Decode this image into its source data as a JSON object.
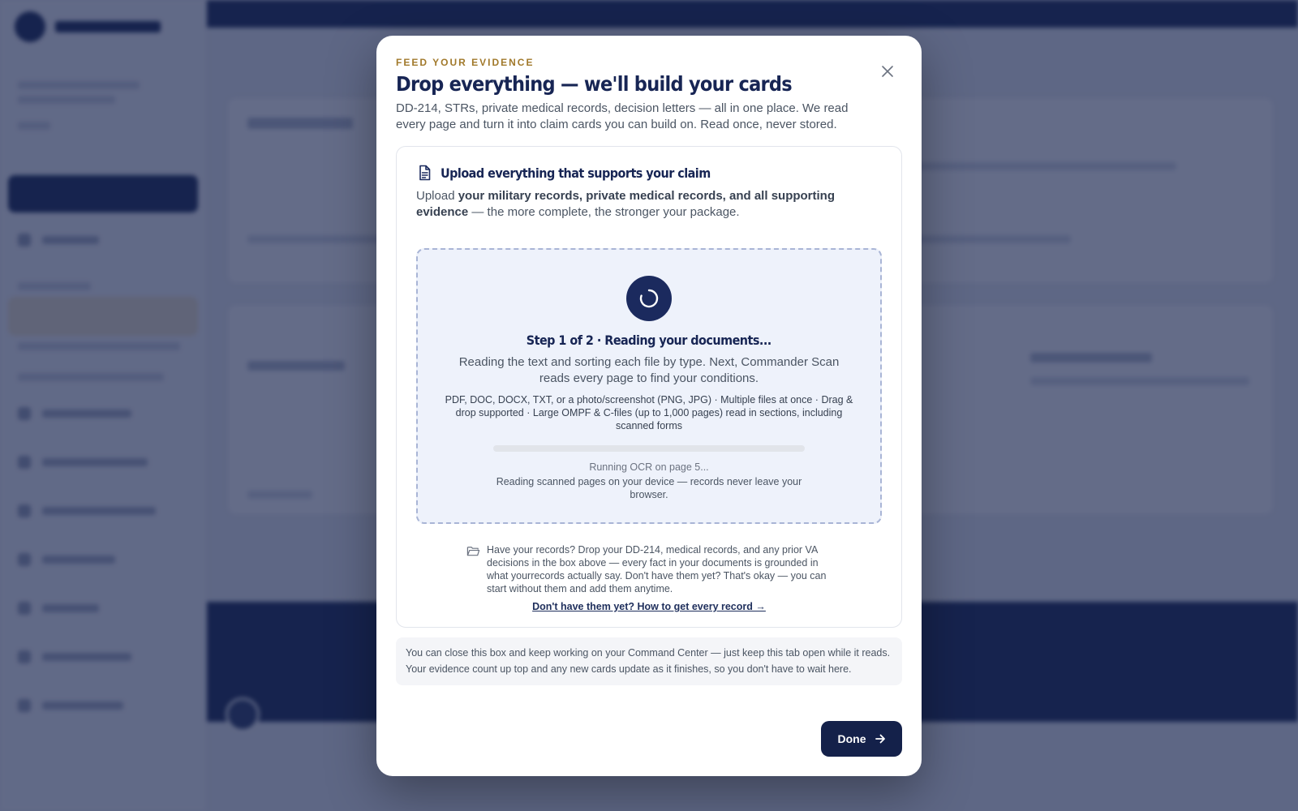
{
  "modal": {
    "eyebrow": "FEED YOUR EVIDENCE",
    "title": "Drop everything — we'll build your cards",
    "intro": "DD-214, STRs, private medical records, decision letters — all in one place. We read every page and turn it into claim cards you can build on. Read once, never stored.",
    "close_icon": "close-icon",
    "panel": {
      "icon": "document-icon",
      "title": "Upload everything that supports your claim",
      "desc_prefix": "Upload ",
      "desc_bold": "your military records, private medical records, and all supporting evidence",
      "desc_suffix": " — the more complete, the stronger your package.",
      "dropzone": {
        "spinner_icon": "spinner-icon",
        "step_title": "Step 1 of 2 · Reading your documents...",
        "step_desc": "Reading the text and sorting each file by type. Next, Commander Scan reads every page to find your conditions.",
        "formats": "PDF, DOC, DOCX, TXT, or a photo/screenshot (PNG, JPG) · Multiple files at once · Drag & drop supported · Large OMPF & C-files (up to 1,000 pages) read in sections, including scanned forms",
        "progress": 0,
        "ocr_status": "Running OCR on page 5...",
        "ocr_note": "Reading scanned pages on your device — records never leave your browser."
      },
      "records_icon": "folder-icon",
      "records_text": "Have your records? Drop your DD-214, medical records, and any prior VA decisions in the box above — every fact in your documents is grounded in what yourrecords actually say. Don't have them yet? That's okay — you can start without them and add them anytime.",
      "records_link": "Don't have them yet? How to get every record →"
    },
    "footer_note": "You can close this box and keep working on your Command Center — just keep this tab open while it reads. Your evidence count up top and any new cards update as it finishes, so you don't have to wait here.",
    "done_label": "Done",
    "done_icon": "arrow-right-icon"
  },
  "colors": {
    "navy": "#14214a",
    "gold": "#a1792b",
    "overlay": "rgba(19, 32, 74, 0.66)"
  }
}
